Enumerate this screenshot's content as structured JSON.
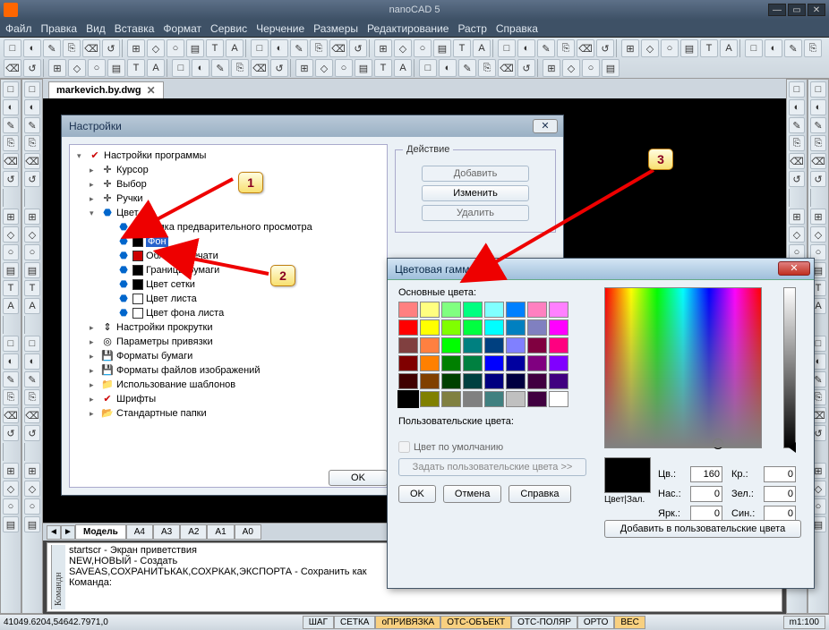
{
  "app": {
    "title": "nanoCAD 5"
  },
  "menu": [
    "Файл",
    "Правка",
    "Вид",
    "Вставка",
    "Формат",
    "Сервис",
    "Черчение",
    "Размеры",
    "Редактирование",
    "Растр",
    "Справка"
  ],
  "doc_tab": "markevich.by.dwg",
  "settings": {
    "title": "Настройки",
    "root": "Настройки программы",
    "items": [
      "Курсор",
      "Выбор",
      "Ручки"
    ],
    "color_group": "Цвет",
    "colors": [
      {
        "label": "Рамка предварительного просмотра",
        "sw": "#c00"
      },
      {
        "label": "Фон",
        "sw": "#000",
        "selected": true
      },
      {
        "label": "Область печати",
        "sw": "#c00"
      },
      {
        "label": "Границы бумаги",
        "sw": "#000"
      },
      {
        "label": "Цвет сетки",
        "sw": "#000"
      },
      {
        "label": "Цвет листа",
        "sw": "#fff"
      },
      {
        "label": "Цвет фона листа",
        "sw": "#fff"
      }
    ],
    "rest": [
      "Настройки прокрутки",
      "Параметры привязки",
      "Форматы бумаги",
      "Форматы файлов изображений",
      "Использование шаблонов",
      "Шрифты",
      "Стандартные папки"
    ],
    "action_legend": "Действие",
    "btn_add": "Добавить",
    "btn_edit": "Изменить",
    "btn_del": "Удалить",
    "ok": "OK"
  },
  "color": {
    "title": "Цветовая гамма",
    "basic": "Основные цвета:",
    "custom": "Пользовательские цвета:",
    "checkbox": "Цвет по умолчанию",
    "define": "Задать пользовательские цвета >>",
    "ok": "OK",
    "cancel": "Отмена",
    "help": "Справка",
    "add": "Добавить в пользовательские цвета",
    "solid": "Цвет|Зал.",
    "hue_l": "Цв.:",
    "hue_v": "160",
    "sat_l": "Нас.:",
    "sat_v": "0",
    "lum_l": "Ярк.:",
    "lum_v": "0",
    "r_l": "Кр.:",
    "r_v": "0",
    "g_l": "Зел.:",
    "g_v": "0",
    "b_l": "Син.:",
    "b_v": "0",
    "palette": [
      "#ff8080",
      "#ffff80",
      "#80ff80",
      "#00ff80",
      "#80ffff",
      "#0080ff",
      "#ff80c0",
      "#ff80ff",
      "#ff0000",
      "#ffff00",
      "#80ff00",
      "#00ff40",
      "#00ffff",
      "#0080c0",
      "#8080c0",
      "#ff00ff",
      "#804040",
      "#ff8040",
      "#00ff00",
      "#008080",
      "#004080",
      "#8080ff",
      "#800040",
      "#ff0080",
      "#800000",
      "#ff8000",
      "#008000",
      "#008040",
      "#0000ff",
      "#0000a0",
      "#800080",
      "#8000ff",
      "#400000",
      "#804000",
      "#004000",
      "#004040",
      "#000080",
      "#000040",
      "#400040",
      "#400080",
      "#000000",
      "#808000",
      "#808040",
      "#808080",
      "#408080",
      "#c0c0c0",
      "#400040",
      "#ffffff"
    ]
  },
  "model_tabs": [
    "Модель",
    "A4",
    "A3",
    "A2",
    "A1",
    "A0"
  ],
  "cmd_label": "Командн",
  "cmd_lines": [
    "startscr - Экран приветствия",
    "NEW,НОВЫЙ - Создать",
    "SAVEAS,СОХРАНИТЬКАК,СОХРКАК,ЭКСПОРТА - Сохранить как",
    "Команда:"
  ],
  "status": {
    "coords": "41049.6204,54642.7971,0",
    "toggles": [
      {
        "t": "ШАГ",
        "on": false
      },
      {
        "t": "СЕТКА",
        "on": false
      },
      {
        "t": "оПРИВЯЗКА",
        "on": true
      },
      {
        "t": "ОТС-ОБЪЕКТ",
        "on": true
      },
      {
        "t": "ОТС-ПОЛЯР",
        "on": false
      },
      {
        "t": "ОРТО",
        "on": false
      },
      {
        "t": "ВЕС",
        "on": true
      }
    ],
    "scale": "m1:100"
  },
  "callouts": {
    "c1": "1",
    "c2": "2",
    "c3": "3"
  }
}
